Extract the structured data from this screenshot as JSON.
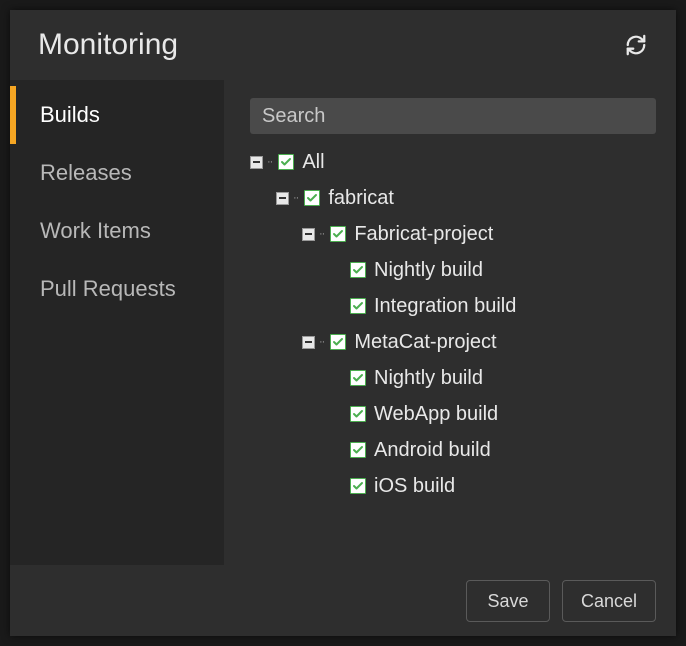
{
  "header": {
    "title": "Monitoring"
  },
  "sidebar": {
    "tabs": [
      {
        "label": "Builds",
        "active": true
      },
      {
        "label": "Releases",
        "active": false
      },
      {
        "label": "Work Items",
        "active": false
      },
      {
        "label": "Pull Requests",
        "active": false
      }
    ]
  },
  "search": {
    "placeholder": "Search",
    "value": ""
  },
  "tree": [
    {
      "label": "All",
      "level": 0,
      "expandable": true,
      "checked": true
    },
    {
      "label": "fabricat",
      "level": 1,
      "expandable": true,
      "checked": true
    },
    {
      "label": "Fabricat-project",
      "level": 2,
      "expandable": true,
      "checked": true
    },
    {
      "label": "Nightly build",
      "level": 3,
      "expandable": false,
      "checked": true
    },
    {
      "label": "Integration build",
      "level": 3,
      "expandable": false,
      "checked": true
    },
    {
      "label": "MetaCat-project",
      "level": 2,
      "expandable": true,
      "checked": true
    },
    {
      "label": "Nightly build",
      "level": 3,
      "expandable": false,
      "checked": true
    },
    {
      "label": "WebApp build",
      "level": 3,
      "expandable": false,
      "checked": true
    },
    {
      "label": "Android build",
      "level": 3,
      "expandable": false,
      "checked": true
    },
    {
      "label": "iOS build",
      "level": 3,
      "expandable": false,
      "checked": true
    }
  ],
  "footer": {
    "save": "Save",
    "cancel": "Cancel"
  },
  "colors": {
    "accent": "#f5a623",
    "check": "#4caf50"
  }
}
